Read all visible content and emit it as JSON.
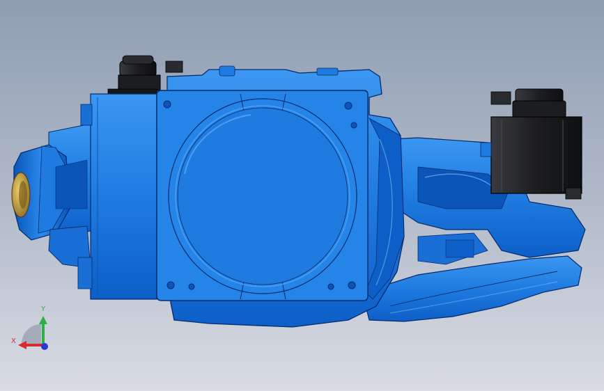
{
  "triad": {
    "x_label": "X",
    "y_label": "Y",
    "x_color": "#d92b2b",
    "y_color": "#2fb043",
    "z_color": "#2a38d9"
  },
  "colors": {
    "part_main": "#1f7be0",
    "part_shadow": "#0b55b8",
    "part_highlight": "#3b97f0",
    "edge": "#062a6a",
    "motor_body": "#1e1f22",
    "bushing": "#c8a030"
  }
}
